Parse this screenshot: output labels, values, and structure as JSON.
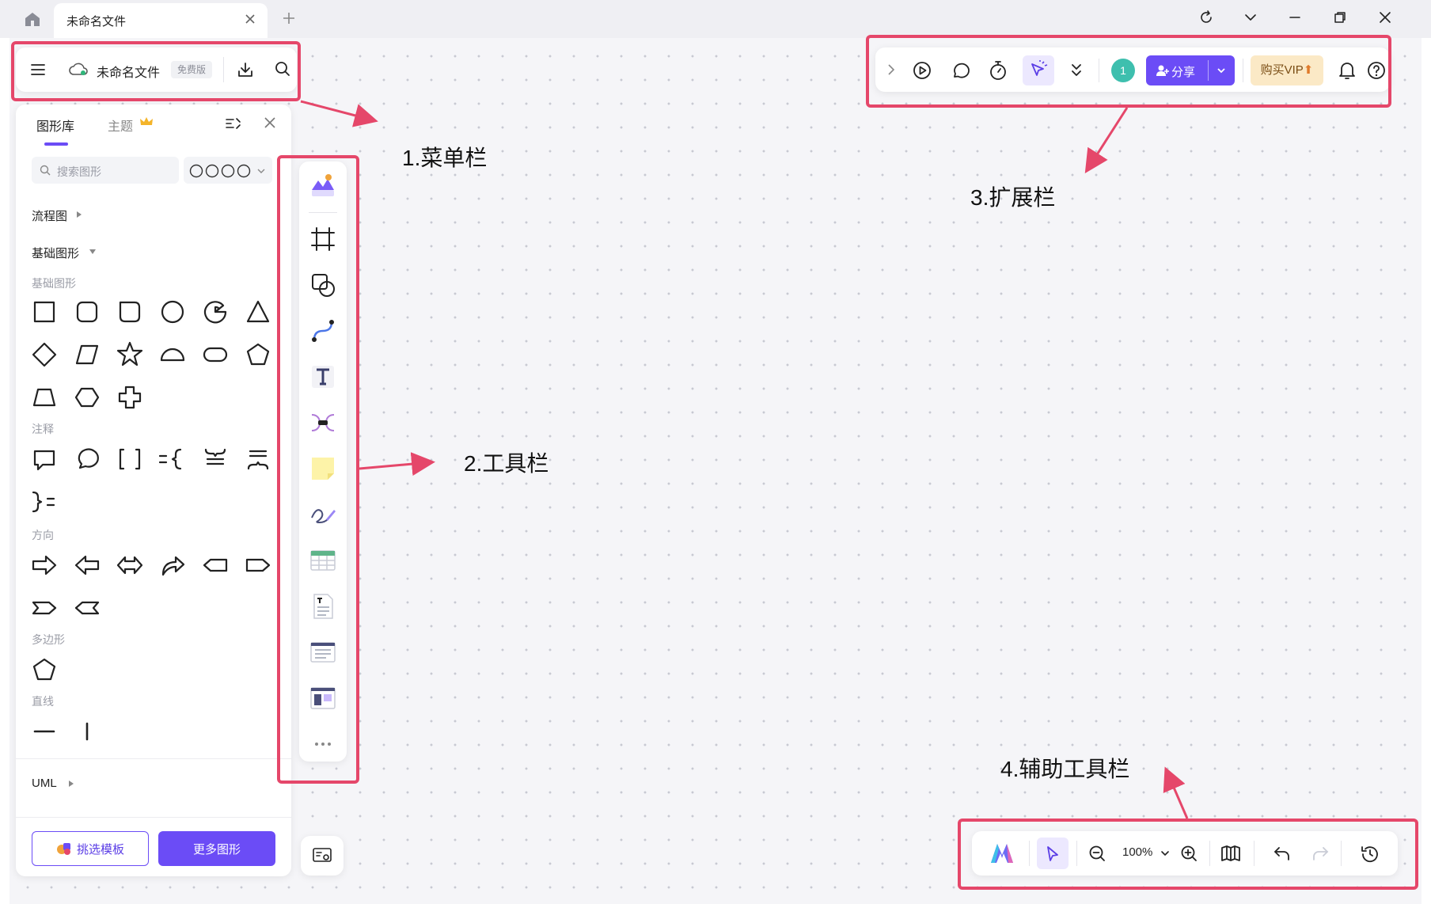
{
  "tab": {
    "title": "未命名文件"
  },
  "menubar": {
    "file_name": "未命名文件",
    "badge": "免费版"
  },
  "shapes_panel": {
    "tab_library": "图形库",
    "tab_theme": "主题",
    "search_placeholder": "搜索图形",
    "section_flowchart": "流程图",
    "section_basic": "基础图形",
    "sub_basic": "基础图形",
    "sub_notes": "注释",
    "sub_direction": "方向",
    "sub_polygon": "多边形",
    "sub_line": "直线",
    "section_uml": "UML",
    "btn_template": "挑选模板",
    "btn_more": "更多图形"
  },
  "extbar": {
    "collab_count": "1",
    "share_label": "分享",
    "vip_label": "购买VIP"
  },
  "assistbar": {
    "zoom": "100%"
  },
  "annotations": {
    "menu": "1.菜单栏",
    "toolbar": "2.工具栏",
    "extension": "3.扩展栏",
    "assist": "4.辅助工具栏"
  },
  "colors": {
    "accent": "#6b4cf6",
    "annotation": "#e5476a",
    "vip_bg": "#fbe9c6",
    "avatar": "#3ebfae"
  }
}
